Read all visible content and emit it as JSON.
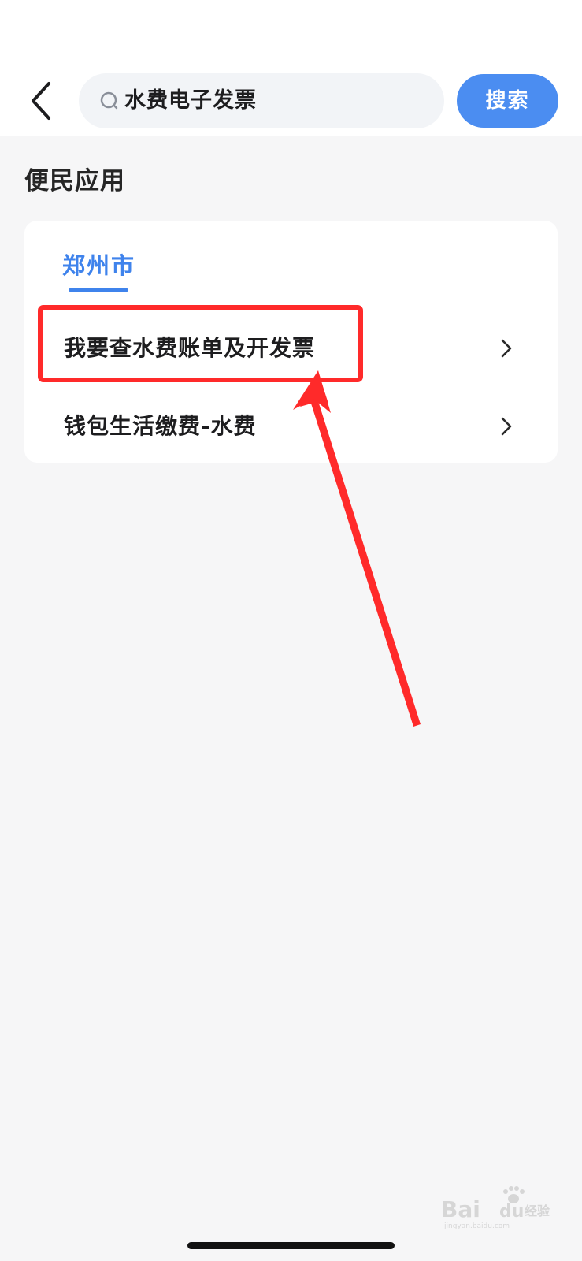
{
  "header": {
    "search_query": "水费电子发票",
    "search_button_label": "搜索"
  },
  "section": {
    "title": "便民应用"
  },
  "card": {
    "city_tab_label": "郑州市",
    "items": [
      {
        "label": "我要查水费账单及开发票"
      },
      {
        "label": "钱包生活缴费-水费"
      }
    ]
  },
  "annotation": {
    "highlight_color": "#ff2a2a",
    "arrow_color": "#ff2a2a"
  },
  "watermark": {
    "text": "Baidu 经验",
    "subtext": "jingyan.baidu.com"
  },
  "colors": {
    "accent": "#4b8df1",
    "tab_active": "#3f83ec",
    "background": "#f6f6f7"
  }
}
